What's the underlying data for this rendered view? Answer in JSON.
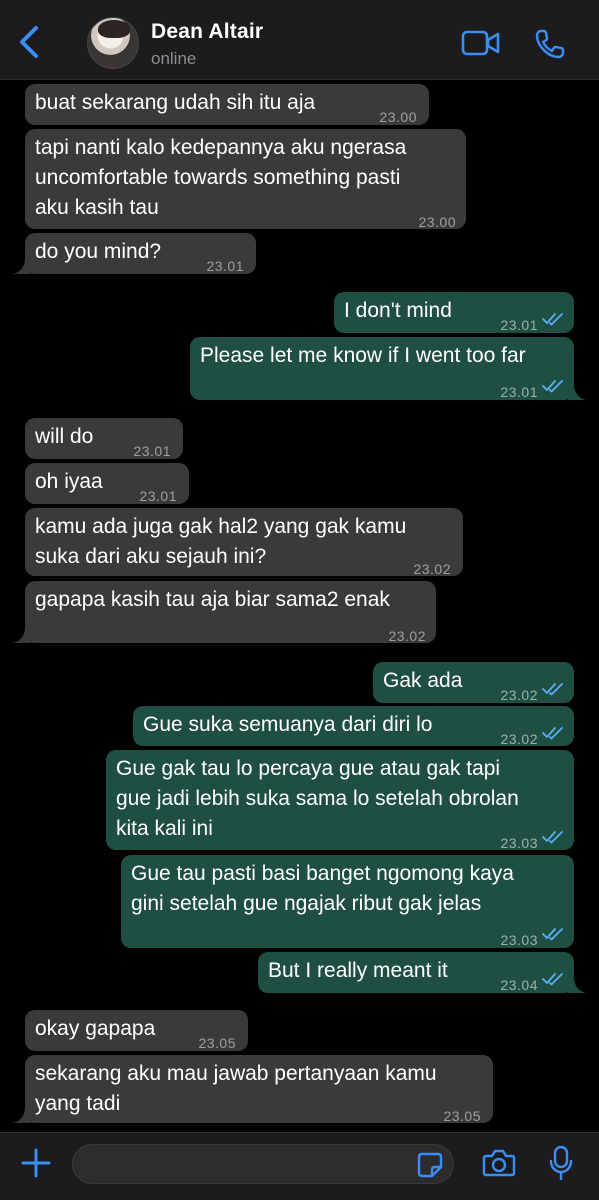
{
  "header": {
    "contact_name": "Dean Altair",
    "status": "online",
    "icons": [
      "back-chevron-icon",
      "video-call-icon",
      "phone-icon"
    ]
  },
  "messages": [
    {
      "dir": "in",
      "text": "buat sekarang udah sih itu aja",
      "time": "23.00"
    },
    {
      "dir": "in",
      "text": "tapi nanti kalo kedepannya aku ngerasa\nuncomfortable towards something pasti\naku kasih tau",
      "time": "23.00"
    },
    {
      "dir": "in",
      "text": "do you mind?",
      "time": "23.01"
    },
    {
      "dir": "out",
      "text": "I don't mind",
      "time": "23.01",
      "read": true
    },
    {
      "dir": "out",
      "text": "Please let me know if I went too far",
      "time": "23.01",
      "read": true
    },
    {
      "dir": "in",
      "text": "will do",
      "time": "23.01"
    },
    {
      "dir": "in",
      "text": "oh iyaa",
      "time": "23.01"
    },
    {
      "dir": "in",
      "text": "kamu ada juga gak hal2 yang gak kamu\nsuka dari aku sejauh ini?",
      "time": "23.02"
    },
    {
      "dir": "in",
      "text": "gapapa kasih tau aja biar sama2 enak",
      "time": "23.02"
    },
    {
      "dir": "out",
      "text": "Gak ada",
      "time": "23.02",
      "read": true
    },
    {
      "dir": "out",
      "text": "Gue suka semuanya dari diri lo",
      "time": "23.02",
      "read": true
    },
    {
      "dir": "out",
      "text": "Gue gak tau lo percaya gue atau gak tapi\ngue jadi lebih suka sama lo setelah obrolan\nkita kali ini",
      "time": "23.03",
      "read": true
    },
    {
      "dir": "out",
      "text": "Gue tau pasti basi banget ngomong kaya\ngini setelah gue ngajak ribut gak jelas",
      "time": "23.03",
      "read": true
    },
    {
      "dir": "out",
      "text": "But I really meant it",
      "time": "23.04",
      "read": true
    },
    {
      "dir": "in",
      "text": "okay gapapa",
      "time": "23.05"
    },
    {
      "dir": "in",
      "text": "sekarang aku mau jawab pertanyaan kamu\nyang tadi",
      "time": "23.05"
    }
  ],
  "footer": {
    "input_value": "",
    "icons": [
      "plus-icon",
      "sticker-icon",
      "camera-icon",
      "microphone-icon"
    ]
  },
  "colors": {
    "incoming_bubble": "#3a3a3c",
    "outgoing_bubble": "#1f4f43",
    "accent": "#3a8ef6",
    "read_tick": "#5ab0f7"
  }
}
